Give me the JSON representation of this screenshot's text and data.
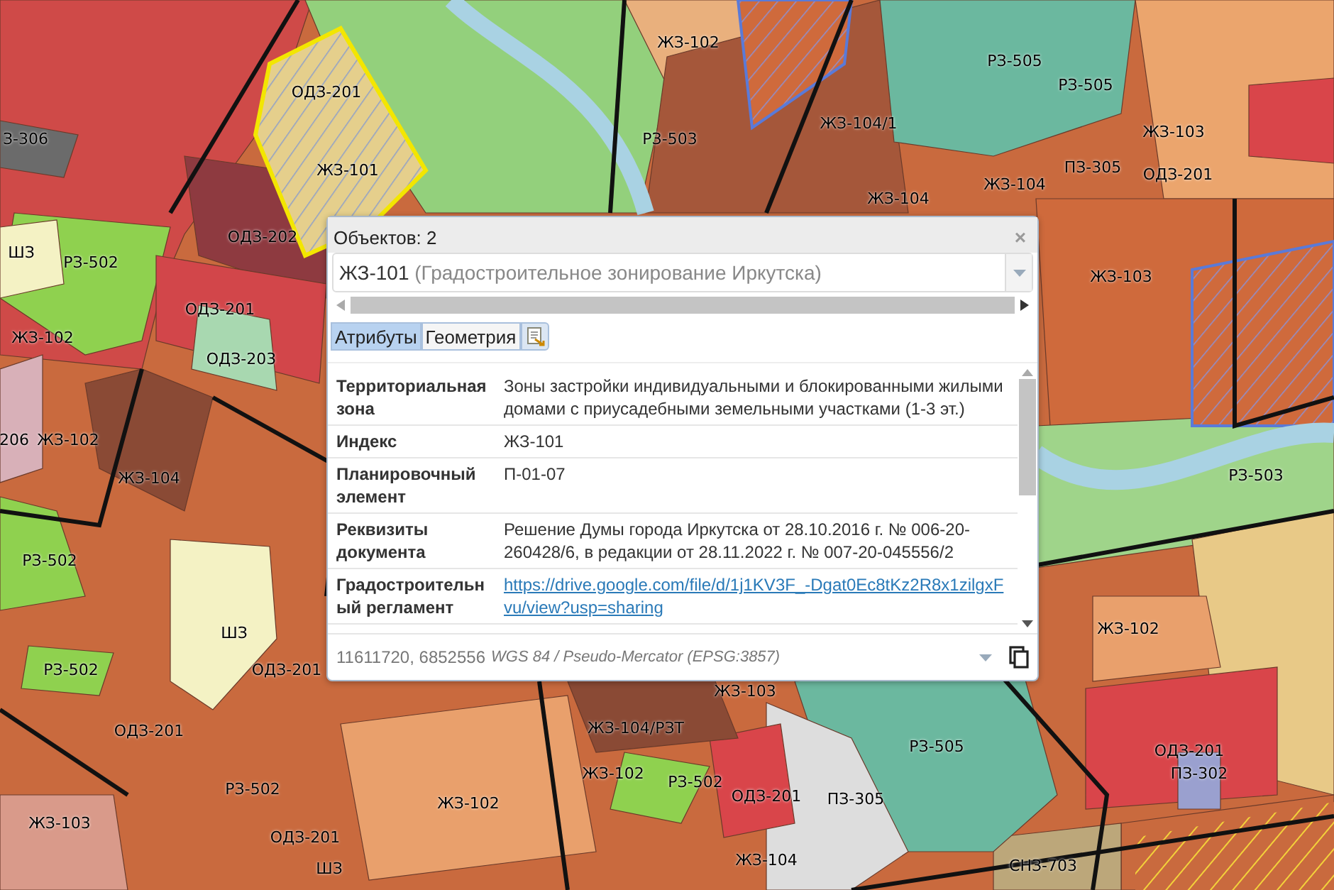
{
  "map": {
    "zone_labels": [
      "ЖЗ-102",
      "РЗ-505",
      "РЗ-505",
      "ОДЗ-201",
      "ЖЗ-104/1",
      "ЖЗ-103",
      "З-306",
      "РЗ-503",
      "ЖЗ-101",
      "ПЗ-305",
      "ОДЗ-201",
      "ЖЗ-104",
      "ЖЗ-104",
      "ОДЗ-202",
      "ШЗ",
      "РЗ-502",
      "ЖЗ-103",
      "ОДЗ-201",
      "ЖЗ-102",
      "ОДЗ-203",
      "206",
      "ЖЗ-102",
      "РЗ-503",
      "ЖЗ-104",
      "РЗ-502",
      "ЖЗ-102",
      "ШЗ",
      "РЗ-502",
      "ОДЗ-201",
      "ЖЗ-103",
      "ЖЗ-104/РЗТ",
      "ОДЗ-201",
      "РЗ-505",
      "ОДЗ-201",
      "ЖЗ-102",
      "ПЗ-302",
      "РЗ-502",
      "ЖЗ-102",
      "РЗ-502",
      "ОДЗ-201",
      "ПЗ-305",
      "ЖЗ-103",
      "ОДЗ-201",
      "ШЗ",
      "ЖЗ-104",
      "СНЗ-703"
    ]
  },
  "popup": {
    "title": "Объектов: 2",
    "close": "×",
    "feature_select": {
      "value": "ЖЗ-101",
      "source": "(Градостроительное зонирование Иркутска)"
    },
    "tabs": [
      {
        "label": "Атрибуты",
        "selected": true
      },
      {
        "label": "Геометрия",
        "selected": false
      }
    ],
    "attributes": [
      {
        "kind": "text",
        "name": "Территориальная зона",
        "value": "Зоны застройки индивидуальными и блокированными жилыми домами с приусадебными земельными участками (1-3 эт.)"
      },
      {
        "kind": "text",
        "name": "Индекс",
        "value": "ЖЗ-101"
      },
      {
        "kind": "text",
        "name": "Планировочный элемент",
        "value": "П-01-07"
      },
      {
        "kind": "text",
        "name": "Реквизиты документа",
        "value": "Решение Думы города Иркутска от 28.10.2016 г. № 006-20-260428/6, в редакции от 28.11.2022 г. № 007-20-045556/2"
      },
      {
        "kind": "link",
        "name": "Градостроительный регламент",
        "value": "https://drive.google.com/file/d/1j1KV3F_-Dgat0Ec8tKz2R8x1zilgxFvu/view?usp=sharing"
      }
    ],
    "footer": {
      "coordinates": "11611720, 6852556",
      "projection": "WGS 84 / Pseudo-Mercator (EPSG:3857)"
    }
  }
}
